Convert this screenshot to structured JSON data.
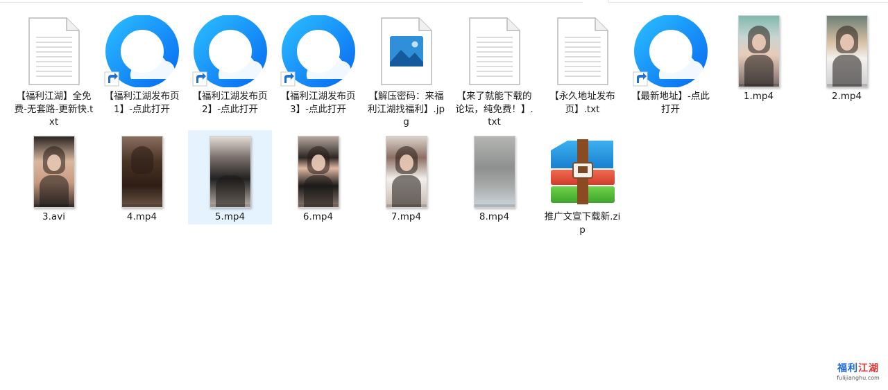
{
  "colors": {
    "selection": "#e5f3ff",
    "browser_blue": "#1e90ff",
    "shortcut_arrow": "#1f6fd1"
  },
  "files": [
    {
      "label": "【福利江湖】全免费-无套路-更新快.txt",
      "icon": "text-document-icon"
    },
    {
      "label": "【福利江湖发布页1】-点此打开",
      "icon": "browser-shortcut-icon"
    },
    {
      "label": "【福利江湖发布页2】-点此打开",
      "icon": "browser-shortcut-icon"
    },
    {
      "label": "【福利江湖发布页3】-点此打开",
      "icon": "browser-shortcut-icon"
    },
    {
      "label": "【解压密码：来福利江湖找福利】.jpg",
      "icon": "image-file-icon"
    },
    {
      "label": "【来了就能下载的论坛，纯免费！】.txt",
      "icon": "text-document-icon"
    },
    {
      "label": "【永久地址发布页】.txt",
      "icon": "text-document-icon"
    },
    {
      "label": "【最新地址】-点此打开",
      "icon": "browser-shortcut-icon"
    },
    {
      "label": "1.mp4",
      "icon": "video-thumbnail"
    },
    {
      "label": "2.mp4",
      "icon": "video-thumbnail"
    },
    {
      "label": "3.avi",
      "icon": "video-thumbnail"
    },
    {
      "label": "4.mp4",
      "icon": "video-thumbnail"
    },
    {
      "label": "5.mp4",
      "icon": "video-thumbnail",
      "selected": true
    },
    {
      "label": "6.mp4",
      "icon": "video-thumbnail"
    },
    {
      "label": "7.mp4",
      "icon": "video-thumbnail"
    },
    {
      "label": "8.mp4",
      "icon": "video-thumbnail"
    },
    {
      "label": "推广文宣下载新.zip",
      "icon": "winrar-archive-icon"
    }
  ],
  "watermark": {
    "text_blue": "福利",
    "text_red": "江湖",
    "url": "fulijianghu.com"
  }
}
